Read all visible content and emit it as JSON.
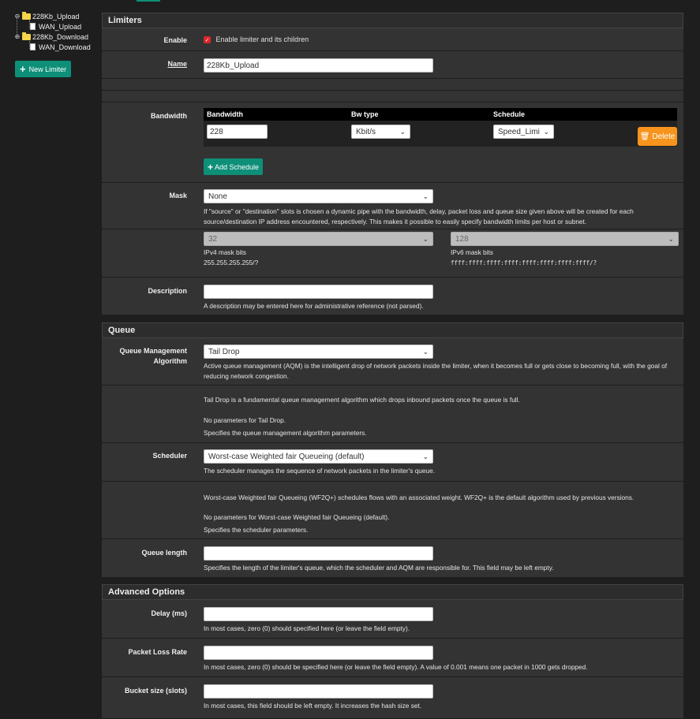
{
  "tree": {
    "items": [
      {
        "label": "228Kb_Upload",
        "child": "WAN_Upload"
      },
      {
        "label": "228Kb_Download",
        "child": "WAN_Download"
      }
    ],
    "new_limiter": "New Limiter"
  },
  "limiters": {
    "title": "Limiters",
    "enable_label": "Enable",
    "enable_text": "Enable limiter and its children",
    "name_label": "Name",
    "name_value": "228Kb_Upload",
    "bandwidth_label": "Bandwidth",
    "bw_headers": [
      "Bandwidth",
      "Bw type",
      "Schedule"
    ],
    "bw_value": "228",
    "bw_type": "Kbit/s",
    "schedule": "Speed_Limi",
    "delete_label": "Delete",
    "add_schedule": "Add Schedule",
    "mask_label": "Mask",
    "mask_value": "None",
    "mask_help": "If \"source\" or \"destination\" slots is chosen a dynamic pipe with the bandwidth, delay, packet loss and queue size given above will be created for each source/destination IP address encountered, respectively. This makes it possible to easily specify bandwidth limits per host or subnet.",
    "ipv4_value": "32",
    "ipv4_label": "IPv4 mask bits",
    "ipv4_sub": "255.255.255.255/?",
    "ipv6_value": "128",
    "ipv6_label": "IPv6 mask bits",
    "ipv6_sub": "ffff:ffff:ffff:ffff:ffff:ffff:ffff:ffff/?",
    "desc_label": "Description",
    "desc_help": "A description may be entered here for administrative reference (not parsed)."
  },
  "queue": {
    "title": "Queue",
    "qma_label": "Queue Management Algorithm",
    "qma_value": "Tail Drop",
    "qma_help": "Active queue management (AQM) is the intelligent drop of network packets inside the limiter, when it becomes full or gets close to becoming full, with the goal of reducing network congestion.",
    "taildrop_desc": "Tail Drop is a fundamental queue management algorithm which drops inbound packets once the queue is full.",
    "taildrop_noparams": "No parameters for Tail Drop.",
    "taildrop_specifies": "Specifies the queue management algorithm parameters.",
    "sched_label": "Scheduler",
    "sched_value": "Worst-case Weighted fair Queueing (default)",
    "sched_help": "The scheduler manages the sequence of network packets in the limiter's queue.",
    "wf2q_desc": "Worst-case Weighted fair Queueing (WF2Q+) schedules flows with an associated weight. WF2Q+ is the default algorithm used by previous versions.",
    "wf2q_noparams": "No parameters for Worst-case Weighted fair Queueing (default).",
    "wf2q_specifies": "Specifies the scheduler parameters.",
    "qlen_label": "Queue length",
    "qlen_help": "Specifies the length of the limiter's queue, which the scheduler and AQM are responsible for. This field may be left empty."
  },
  "advanced": {
    "title": "Advanced Options",
    "delay_label": "Delay (ms)",
    "delay_help": "In most cases, zero (0) should specified here (or leave the field empty).",
    "plr_label": "Packet Loss Rate",
    "plr_help": "In most cases, zero (0) should be specified here (or leave the field empty). A value of 0.001 means one packet in 1000 gets dropped.",
    "bucket_label": "Bucket size (slots)",
    "bucket_help": "In most cases, this field should be left empty. It increases the hash size set."
  },
  "colors": {
    "accent": "#0e8f78",
    "danger": "#f7941d",
    "check": "#d9262b"
  }
}
